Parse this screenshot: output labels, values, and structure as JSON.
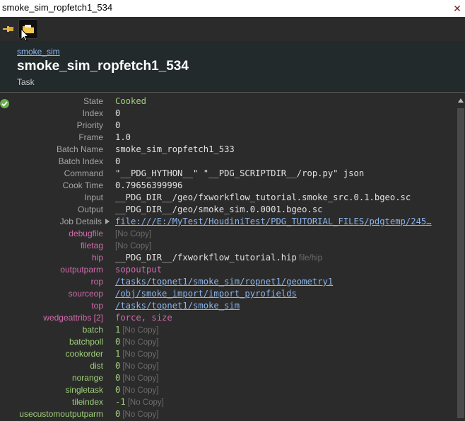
{
  "window": {
    "title": "smoke_sim_ropfetch1_534",
    "close_glyph": "✕"
  },
  "toolbar": {
    "pin_icon": "pin-icon",
    "folder_icon": "folder-icon"
  },
  "header": {
    "parent_link": "smoke_sim",
    "title": "smoke_sim_ropfetch1_534",
    "type": "Task"
  },
  "colors": {
    "label_gray": "#a6a6a6",
    "label_pink": "#d36aab",
    "label_green": "#9fd07a",
    "link": "#8ab4ea",
    "status_ok": "#6ab04c"
  },
  "details": {
    "state": {
      "label": "State",
      "value": "Cooked"
    },
    "index": {
      "label": "Index",
      "value": "0"
    },
    "priority": {
      "label": "Priority",
      "value": "0"
    },
    "frame": {
      "label": "Frame",
      "value": "1.0"
    },
    "batch_name": {
      "label": "Batch Name",
      "value": "smoke_sim_ropfetch1_533"
    },
    "batch_index": {
      "label": "Batch Index",
      "value": "0"
    },
    "command": {
      "label": "Command",
      "value": "\"__PDG_HYTHON__\" \"__PDG_SCRIPTDIR__/rop.py\" json"
    },
    "cook_time": {
      "label": "Cook Time",
      "value": "0.79656399996"
    },
    "input": {
      "label": "Input",
      "value": "__PDG_DIR__/geo/fxworkflow_tutorial.smoke_src.0.1.bgeo.sc"
    },
    "output": {
      "label": "Output",
      "value": "__PDG_DIR__/geo/smoke_sim.0.0001.bgeo.sc"
    },
    "job_details": {
      "label": "Job Details",
      "value": "file:///E:/MyTest/HoudiniTest/PDG_TUTORIAL_FILES/pdgtemp/245…"
    }
  },
  "attributes": {
    "debugfile": {
      "label": "debugfile",
      "note": "[No Copy]"
    },
    "filetag": {
      "label": "filetag",
      "note": "[No Copy]"
    },
    "hip": {
      "label": "hip",
      "value": "__PDG_DIR__/fxworkflow_tutorial.hip",
      "note": "file/hip"
    },
    "outputparm": {
      "label": "outputparm",
      "value": "sopoutput"
    },
    "rop": {
      "label": "rop",
      "value": "/tasks/topnet1/smoke_sim/ropnet1/geometry1"
    },
    "sourceop": {
      "label": "sourceop",
      "value": "/obj/smoke_import/import_pyrofields"
    },
    "top": {
      "label": "top",
      "value": "/tasks/topnet1/smoke_sim"
    },
    "wedgeattribs": {
      "label": "wedgeattribs [2]",
      "value": "force, size"
    },
    "batch": {
      "label": "batch",
      "value": "1",
      "note": "[No Copy]"
    },
    "batchpoll": {
      "label": "batchpoll",
      "value": "0",
      "note": "[No Copy]"
    },
    "cookorder": {
      "label": "cookorder",
      "value": "1",
      "note": "[No Copy]"
    },
    "dist": {
      "label": "dist",
      "value": "0",
      "note": "[No Copy]"
    },
    "norange": {
      "label": "norange",
      "value": "0",
      "note": "[No Copy]"
    },
    "singletask": {
      "label": "singletask",
      "value": "0",
      "note": "[No Copy]"
    },
    "tileindex": {
      "label": "tileindex",
      "value": "-1",
      "note": "[No Copy]"
    },
    "usecustomoutputparm": {
      "label": "usecustomoutputparm",
      "value": "0",
      "note": "[No Copy]"
    }
  }
}
